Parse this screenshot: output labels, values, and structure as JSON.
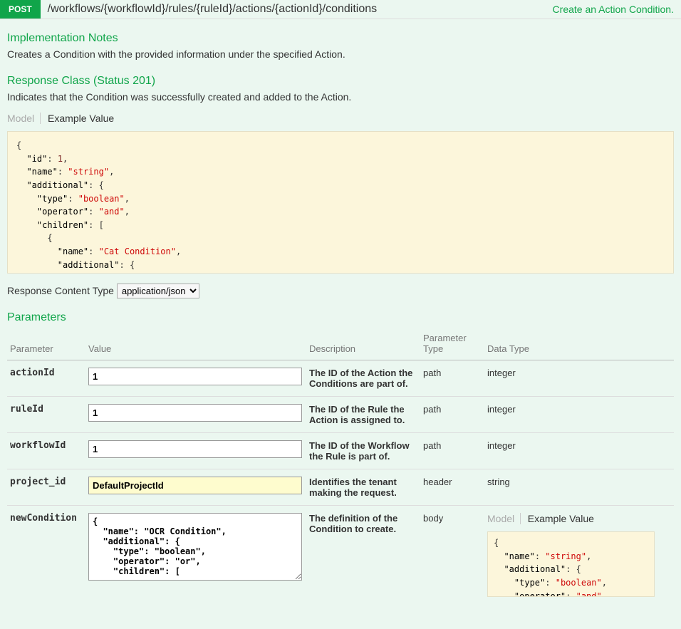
{
  "method": "POST",
  "path": "/workflows/{workflowId}/rules/{ruleId}/actions/{actionId}/conditions",
  "summary": "Create an Action Condition.",
  "impl_heading": "Implementation Notes",
  "impl_text": "Creates a Condition with the provided information under the specified Action.",
  "resp_heading": "Response Class (Status 201)",
  "resp_text": "Indicates that the Condition was successfully created and added to the Action.",
  "tab_model": "Model",
  "tab_example": "Example Value",
  "content_type_label": "Response Content Type",
  "content_type_value": "application/json",
  "params_heading": "Parameters",
  "th": {
    "param": "Parameter",
    "value": "Value",
    "desc": "Description",
    "ptype": "Parameter Type",
    "dtype": "Data Type"
  },
  "rows": [
    {
      "name": "actionId",
      "value": "1",
      "desc": "The ID of the Action the Conditions are part of.",
      "ptype": "path",
      "dtype": "integer",
      "highlight": false
    },
    {
      "name": "ruleId",
      "value": "1",
      "desc": "The ID of the Rule the Action is assigned to.",
      "ptype": "path",
      "dtype": "integer",
      "highlight": false
    },
    {
      "name": "workflowId",
      "value": "1",
      "desc": "The ID of the Workflow the Rule is part of.",
      "ptype": "path",
      "dtype": "integer",
      "highlight": false
    },
    {
      "name": "project_id",
      "value": "DefaultProjectId",
      "desc": "Identifies the tenant making the request.",
      "ptype": "header",
      "dtype": "string",
      "highlight": true
    }
  ],
  "body_row": {
    "name": "newCondition",
    "value": "{\n  \"name\": \"OCR Condition\",\n  \"additional\": {\n    \"type\": \"boolean\",\n    \"operator\": \"or\",\n    \"children\": [",
    "desc": "The definition of the Condition to create.",
    "ptype": "body"
  },
  "colors": {
    "method_bg": "#10a54a",
    "page_bg": "#ebf7f0",
    "json_bg": "#fcf6db",
    "highlight_bg": "#fefcce"
  }
}
